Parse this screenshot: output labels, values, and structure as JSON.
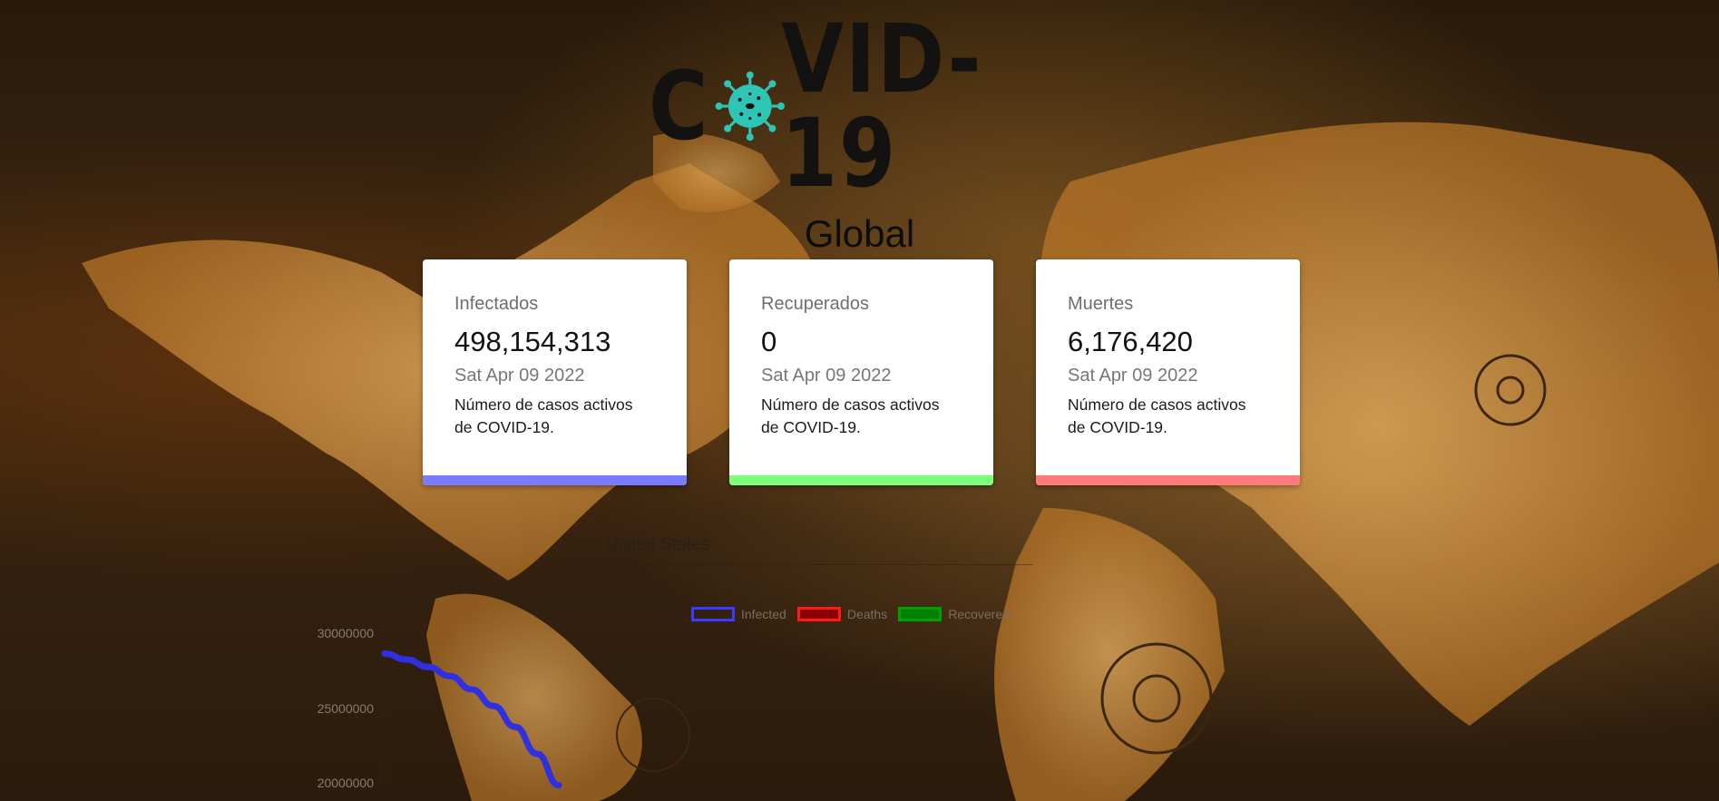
{
  "logo": {
    "text_before": "C",
    "text_after": "VID-19",
    "virus_color": "#2ec4b6"
  },
  "global": {
    "title": "Global"
  },
  "cards": [
    {
      "label": "Infectados",
      "value": "498,154,313",
      "date": "Sat Apr 09 2022",
      "description": "Número de casos activos de COVID-19.",
      "color": "#7b7bff"
    },
    {
      "label": "Recuperados",
      "value": "0",
      "date": "Sat Apr 09 2022",
      "description": "Número de casos activos de COVID-19.",
      "color": "#7dff7d"
    },
    {
      "label": "Muertes",
      "value": "6,176,420",
      "date": "Sat Apr 09 2022",
      "description": "Número de casos activos de COVID-19.",
      "color": "#ff7b7b"
    }
  ],
  "chart": {
    "country": "United States",
    "legend": [
      {
        "name": "Infected",
        "border": "#3b3bff",
        "fill": "transparent"
      },
      {
        "name": "Deaths",
        "border": "#ff1a1a",
        "fill": "#8b0000"
      },
      {
        "name": "Recovered",
        "border": "#00a000",
        "fill": "#008000"
      }
    ],
    "y_ticks": [
      "30000000",
      "25000000",
      "20000000"
    ]
  },
  "chart_data": {
    "type": "line",
    "title": "",
    "xlabel": "",
    "ylabel": "",
    "ylim": [
      18000000,
      31000000
    ],
    "series": [
      {
        "name": "Infected",
        "color": "#3030e0",
        "values": [
          28700000,
          28300000,
          27800000,
          27200000,
          26300000,
          25200000,
          23800000,
          22000000,
          19900000
        ]
      }
    ]
  }
}
